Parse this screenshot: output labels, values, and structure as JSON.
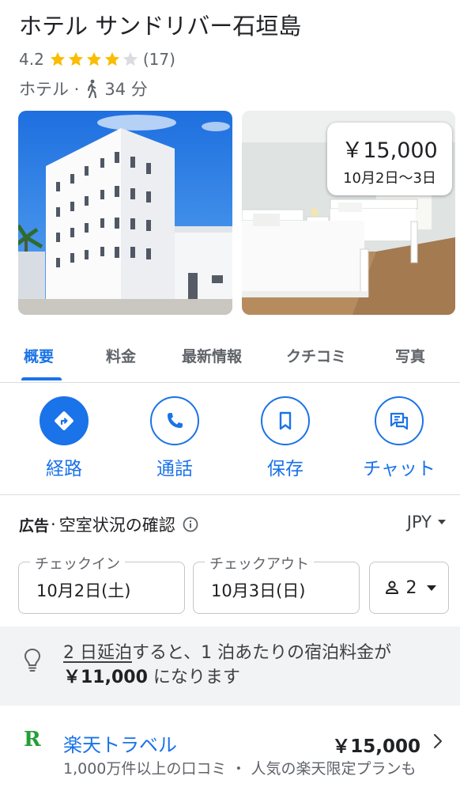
{
  "hotel": {
    "title": "ホテル サンドリバー石垣島",
    "rating": "4.2",
    "stars_filled": 4,
    "stars_total": 5,
    "review_count": "(17)",
    "category": "ホテル · ",
    "walk_time": "34 分"
  },
  "photo_price": {
    "price": "￥15,000",
    "dates": "10月2日〜3日"
  },
  "tabs": [
    {
      "label": "概要",
      "active": true
    },
    {
      "label": "料金",
      "active": false
    },
    {
      "label": "最新情報",
      "active": false
    },
    {
      "label": "クチコミ",
      "active": false
    },
    {
      "label": "写真",
      "active": false
    }
  ],
  "actions": [
    {
      "label": "経路",
      "icon": "directions-icon"
    },
    {
      "label": "通話",
      "icon": "phone-icon"
    },
    {
      "label": "保存",
      "icon": "bookmark-icon"
    },
    {
      "label": "チャット",
      "icon": "chat-icon"
    }
  ],
  "booking": {
    "ad_label": "広告",
    "separator": "·",
    "availability": "空室状況の確認",
    "currency": "JPY",
    "checkin_label": "チェックイン",
    "checkin_value": "10月2日(土)",
    "checkout_label": "チェックアウト",
    "checkout_value": "10月3日(日)",
    "guests": "2"
  },
  "tip": {
    "link": "2 日延泊",
    "text1": "すると、1 泊あたりの宿泊料金が",
    "price": "￥11,000",
    "text2": " になります"
  },
  "listing": {
    "logo": "R",
    "name": "楽天トラベル",
    "price": "￥15,000",
    "description": "1,000万件以上の口コミ ・ 人気の楽天限定プランも"
  },
  "colors": {
    "accent": "#1a73e8",
    "star": "#fbbc04",
    "star_empty": "#dadce0",
    "rakuten_green": "#22a036"
  }
}
